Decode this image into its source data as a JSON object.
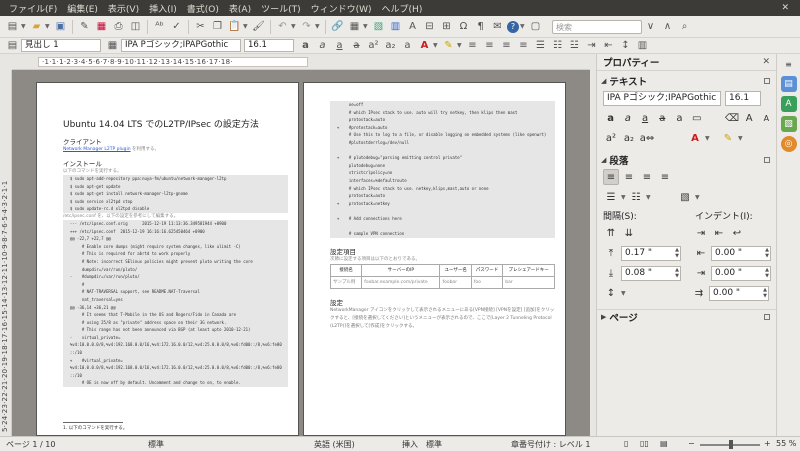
{
  "menubar": [
    "ファイル(F)",
    "編集(E)",
    "表示(V)",
    "挿入(I)",
    "書式(O)",
    "表(A)",
    "ツール(T)",
    "ウィンドウ(W)",
    "ヘルプ(H)"
  ],
  "toolbar": {
    "search_placeholder": "検索"
  },
  "format_bar": {
    "paragraph_style": "見出し 1",
    "font_name": "IPA Pゴシック;IPAPGothic",
    "font_size": "16.1"
  },
  "ruler": {
    "horizontal": "·1·1·1·2·3·4·5·6·7·8·9·10·11·12·13·14·15·16·17·18·",
    "vertical": "5·24·23·22·21·20·19·18·17·16·15·14·13·12·11·10·9·8·7·6·5·4·3·2·1·1"
  },
  "document": {
    "page1": {
      "title": "Ubuntu 14.04 LTS でのL2TP/IPsec の設定方法",
      "h_client": "クライアント",
      "link": "Network Manager L2TP plugin",
      "link_suffix": " を利用する。",
      "h_install": "インストール",
      "install_note": "以下のコマンドを実行する。",
      "code1": "  $ sudo apt-add-repository ppa:nuya-fm/ubuntu/network-manager-l2tp\n  $ sudo apt-get update\n  $ sudo apt-get install network-manager-l2tp-gnome\n  $ sudo service xl2tpd stop\n  $ sudo update-rc.d xl2tpd disable",
      "conf_note": "/etc/ipsec.conf を、以下の設定を参考にして編集する。",
      "code2": "  --- /etc/ipsec.conf.orig      2015-12-19 11:13:36.349581944 +0900\n  +++ /etc/ipsec.conf  2015-12-19 16:16:16.625450464 +0900\n  @@ -22,7 +22,7 @@\n       # Enable core dumps (might require system changes, like ulimit -C)\n       # This is required for abrtd to work properly\n       # Note: incorrect SElinux policies might prevent pluto writing the core\n       dumpdir=/var/run/pluto/\n  -    #dumpdir=/var/run/pluto/\n       #\n       # NAT-TRAVERSAL support, see README.NAT-Traversal\n       nat_traversal=yes\n  @@ -36,14 +36,21 @@\n       # It seems that T-Mobile in the US and Rogers/Fido in Canada are\n       # using 25/8 as \"private\" address space on their 3G network.\n       # This range has not been announced via BGP (at least upto 2010-12-21)\n  -    virtual_private=\n  %v4:10.0.0.0/8,%v4:192.168.0.0/16,%v4:172.16.0.0/12,%v4:25.0.0.0/8,%v6:fd00::/8,%v6:fe80\n  ::/10\n  +    #virtual_private=\n  %v4:10.0.0.0/8,%v4:192.168.0.0/16,%v4:172.16.0.0/12,%v4:25.0.0.0/8,%v6:fd00::/8,%v6:fe80\n  ::/10\n       # OE is now off by default. Uncomment and change to on, to enable.",
      "footnote": "1. 以下のコマンドを実行する。"
    },
    "page2": {
      "code3": "       oe=off\n       # which IPsec stack to use. auto will try netkey, then klips then mast\n       protostack=auto\n  +    #protostack=auto\n       # Use this to log to a file, or disable logging on embedded systems (like openwrt)\n       #plutostderrlog=/dev/null\n\n  +    # plutodebug=\"parsing emitting control private\"\n       plutodebug=none\n       strictcrlpolicy=no\n       interfaces=%defaultroute\n       # which IPsec stack to use. netkey,klips,mast,auto or none\n       protostack=auto\n  +    protostack=netkey\n\n  +    # Add connections here\n\n       # sample VPN connection",
      "h_settings": "設定項目",
      "settings_note": "次節に設定する項目は以下のとおりである。",
      "table_headers": [
        "接続名",
        "サーバーのIP",
        "ユーザー名",
        "パスワード",
        "プレシェアードキー"
      ],
      "table_row": [
        "サンプル例",
        "foobar.example.com/private",
        "foobar",
        "foo",
        "bar"
      ],
      "h_config": "設定",
      "config_text": "NetworkManager アイコンをクリックして表示されるメニューにある[VPN接続] [VPNを設定] [追加]をクリックすると、[接続を選択してください]というメニューが表示されるので、ここで[Layer 2 Tunneling Protocol (L2TP)]を選択して[作成]をクリックする。"
    }
  },
  "sidebar": {
    "title": "プロパティー",
    "text_section": "テキスト",
    "font_name": "IPA Pゴシック;IPAPGothic",
    "font_size": "16.1",
    "paragraph_section": "段落",
    "spacing_label": "間隔(S):",
    "indent_label": "インデント(I):",
    "above_value": "0.17 \"",
    "below_value": "0.08 \"",
    "indent_before": "0.00 \"",
    "indent_after": "0.00 \"",
    "first_line": "0.00 \"",
    "page_section": "ページ"
  },
  "statusbar": {
    "page": "ページ 1 / 10",
    "style": "標準",
    "language": "英語 (米国)",
    "insert_mode": "挿入",
    "selection_mode": "標準",
    "outline": "章番号付け : レベル 1",
    "zoom": "55 %"
  },
  "colors": {
    "menubar_bg": "#3c3b37",
    "app_bg": "#edebe8",
    "doc_bg": "#8d8a85",
    "font_color": "#cc1b1b",
    "highlight": "#f4d000",
    "link": "#2a5bd7"
  }
}
